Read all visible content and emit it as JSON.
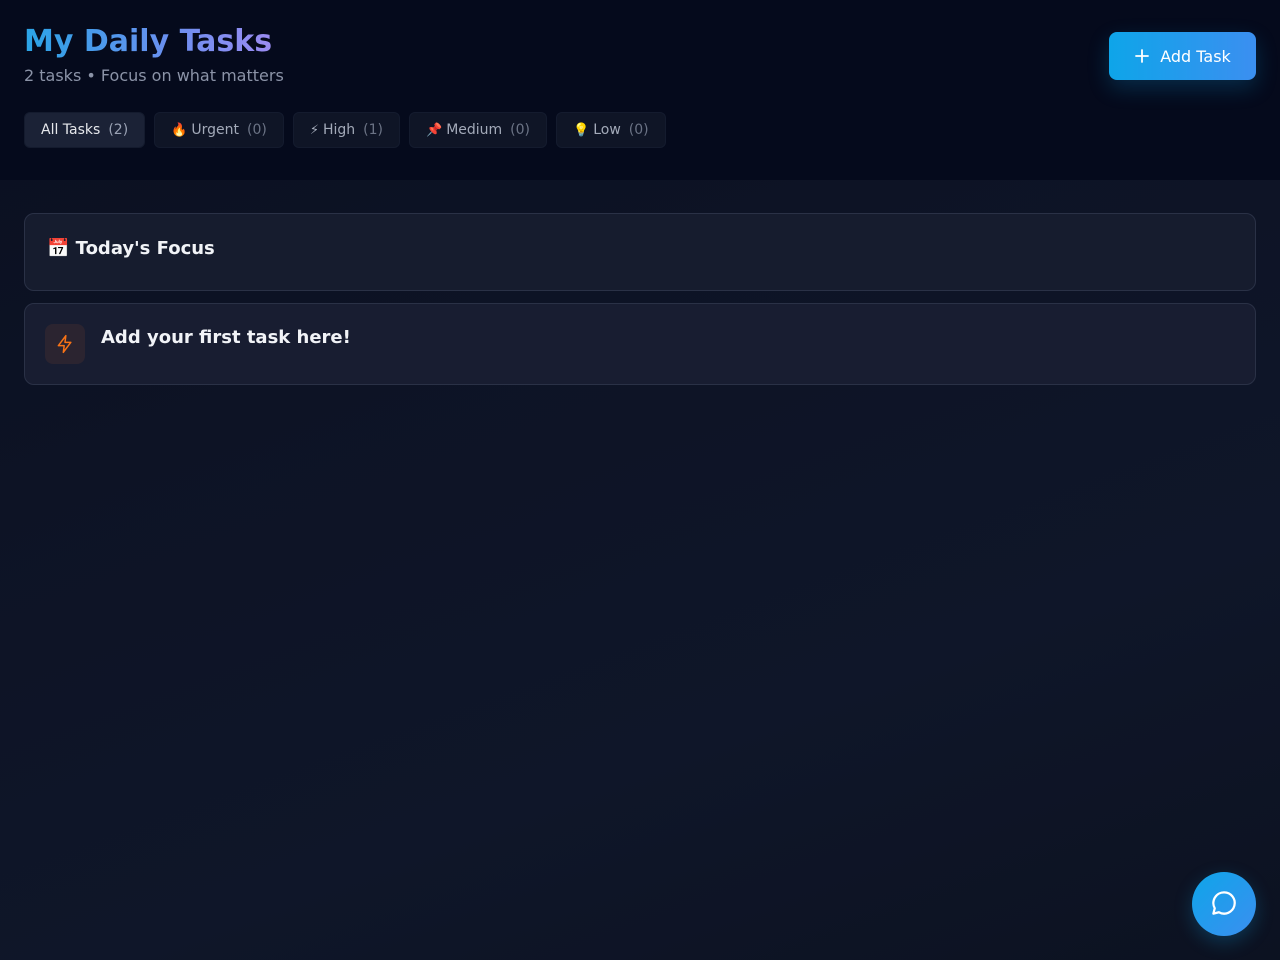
{
  "header": {
    "title": "My Daily Tasks",
    "subtitle": "2 tasks • Focus on what matters",
    "add_button_label": "Add Task"
  },
  "filters": [
    {
      "emoji": "",
      "label": "All Tasks",
      "count": "(2)"
    },
    {
      "emoji": "🔥",
      "label": "Urgent",
      "count": "(0)"
    },
    {
      "emoji": "⚡",
      "label": "High",
      "count": "(1)"
    },
    {
      "emoji": "📌",
      "label": "Medium",
      "count": "(0)"
    },
    {
      "emoji": "💡",
      "label": "Low",
      "count": "(0)"
    }
  ],
  "focus": {
    "title": "📅 Today's Focus"
  },
  "tasks": [
    {
      "title": "Add your first task here!",
      "icon": "lightning-icon"
    }
  ],
  "icons": {
    "add": "plus-icon",
    "chat": "chat-bubble-icon"
  },
  "colors": {
    "accent": "#0ea5e9",
    "accent_secondary": "#3b8ff0",
    "high_priority": "#f97316",
    "background": "#0d1325"
  }
}
